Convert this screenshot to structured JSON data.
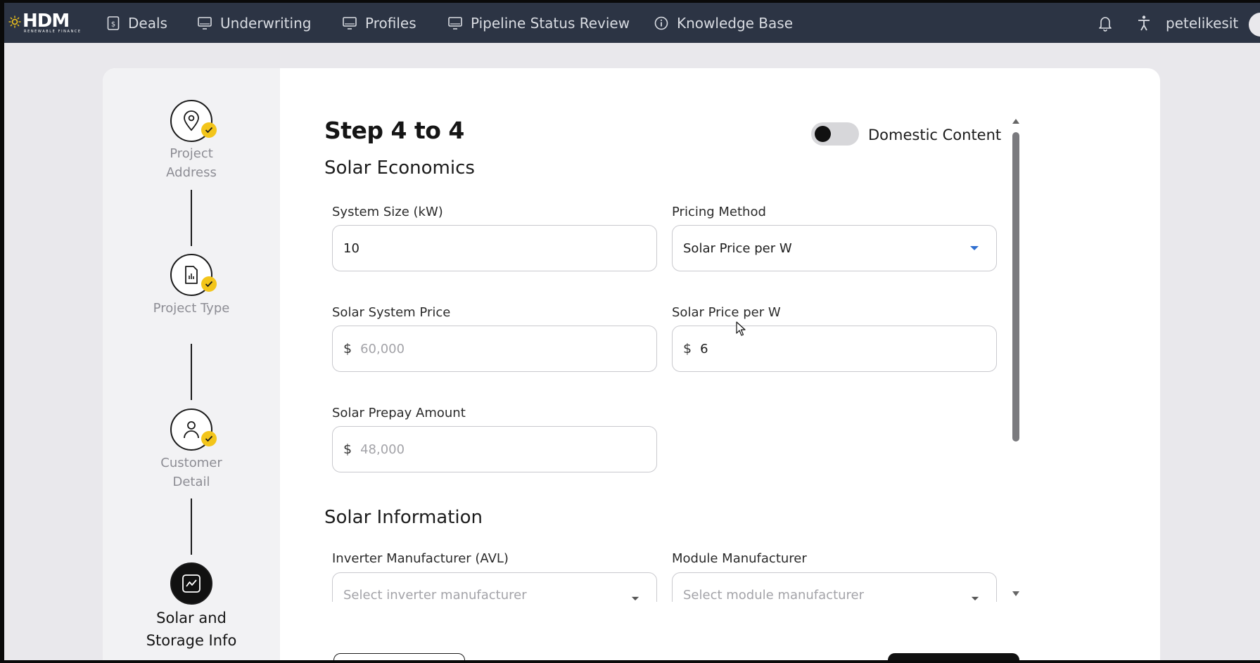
{
  "nav": {
    "brand": "HDM",
    "brand_sub": "RENEWABLE FINANCE",
    "items": [
      {
        "label": "Deals",
        "icon": "dollar-doc-icon"
      },
      {
        "label": "Underwriting",
        "icon": "monitor-icon"
      },
      {
        "label": "Profiles",
        "icon": "monitor-icon"
      },
      {
        "label": "Pipeline Status Review",
        "icon": "monitor-icon"
      },
      {
        "label": "Knowledge Base",
        "icon": "info-icon"
      }
    ],
    "username": "petelikesit"
  },
  "stepper": {
    "steps": [
      {
        "label_line1": "Project",
        "label_line2": "Address",
        "icon": "location-pin-icon",
        "status": "complete"
      },
      {
        "label_line1": "Project Type",
        "label_line2": "",
        "icon": "document-chart-icon",
        "status": "complete"
      },
      {
        "label_line1": "Customer",
        "label_line2": "Detail",
        "icon": "user-icon",
        "status": "complete"
      },
      {
        "label_line1": "Solar and",
        "label_line2": "Storage Info",
        "icon": "chart-trend-icon",
        "status": "active"
      }
    ]
  },
  "form": {
    "step_title": "Step 4 to 4",
    "domestic_content_label": "Domestic Content",
    "domestic_content_on": false,
    "solar_economics_title": "Solar Economics",
    "system_size": {
      "label": "System Size (kW)",
      "value": "10"
    },
    "pricing_method": {
      "label": "Pricing Method",
      "value": "Solar Price per W"
    },
    "solar_system_price": {
      "label": "Solar System Price",
      "currency": "$",
      "placeholder": "60,000"
    },
    "solar_price_per_w": {
      "label": "Solar Price per W",
      "currency": "$",
      "value": "6"
    },
    "solar_prepay_amount": {
      "label": "Solar Prepay Amount",
      "currency": "$",
      "placeholder": "48,000"
    },
    "solar_information_title": "Solar Information",
    "inverter_manufacturer": {
      "label": "Inverter Manufacturer (AVL)",
      "placeholder": "Select inverter manufacturer"
    },
    "module_manufacturer": {
      "label": "Module Manufacturer",
      "placeholder": "Select module manufacturer"
    }
  },
  "colors": {
    "nav_bg": "#2c3444",
    "badge": "#f3c51a",
    "accent_chevron": "#2f6fd0"
  }
}
